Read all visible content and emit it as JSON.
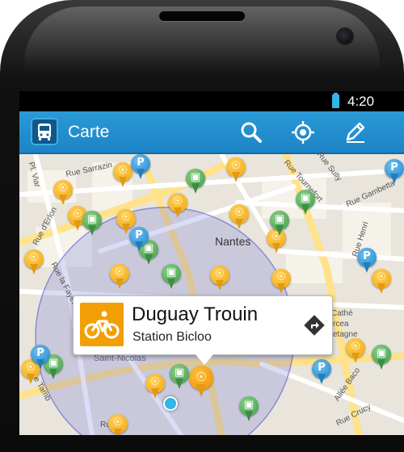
{
  "status_bar": {
    "time": "4:20"
  },
  "action_bar": {
    "title": "Carte",
    "actions": [
      "search-icon",
      "locate-icon",
      "edit-icon"
    ]
  },
  "map": {
    "place_label": "Nantes",
    "place_label_2": "Saint-Nicolas",
    "roads": [
      "Rue Sarrazin",
      "Rue d'Erlon",
      "Pl. Viar",
      "Rue Tournefort",
      "Rue Sully",
      "Rue Gambetta",
      "Rue Henri",
      "Rue la Fayette",
      "Allée Baco",
      "Rue Crucy",
      "Rue Tamb",
      "Rue",
      "Cathé",
      "rcea",
      "etagne"
    ]
  },
  "info_window": {
    "title": "Duguay Trouin",
    "subtitle": "Station Bicloo",
    "icon": "bike-icon",
    "action_icon": "directions-icon"
  },
  "colors": {
    "accent": "#1e8bcc",
    "bike": "#f1a40f",
    "bus": "#3d9a47",
    "parking": "#1f86c9"
  }
}
